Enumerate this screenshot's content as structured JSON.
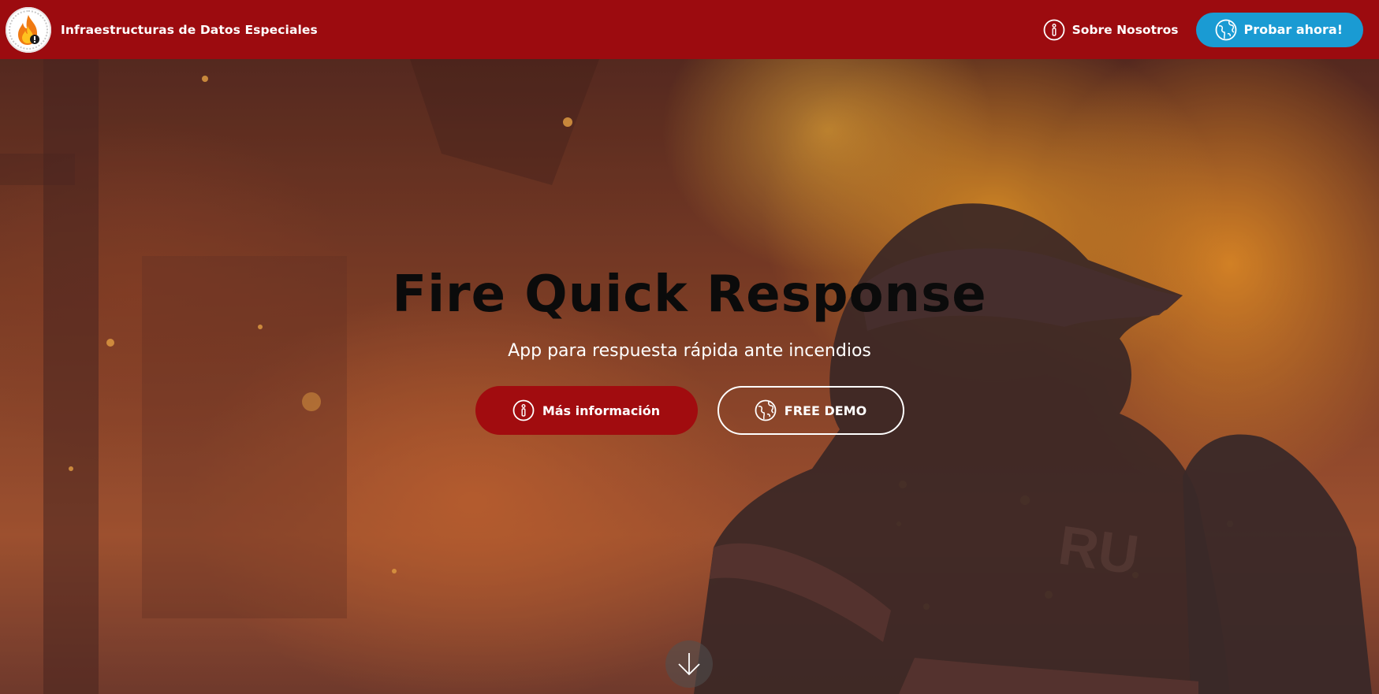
{
  "navbar": {
    "brand_name": "Infraestructuras de Datos Especiales",
    "logo_icon": "flame-warning-logo",
    "about_label": "Sobre Nosotros",
    "about_icon": "info-icon",
    "cta_label": "Probar ahora!",
    "cta_icon": "globe-icon"
  },
  "hero": {
    "title": "Fire Quick Response",
    "subtitle": "App para respuesta rápida ante incendios",
    "primary_button_label": "Más información",
    "primary_button_icon": "info-icon",
    "secondary_button_label": "FREE DEMO",
    "secondary_button_icon": "globe-icon",
    "scroll_icon": "arrow-down-icon",
    "background_image": "firefighter-in-flames"
  },
  "colors": {
    "navbar_bg": "#9c0b0f",
    "cta_bg": "#1a9bd3",
    "primary_button_bg": "#a10c0f",
    "title_color": "#0b0b0b",
    "text_light": "#ffffff"
  }
}
